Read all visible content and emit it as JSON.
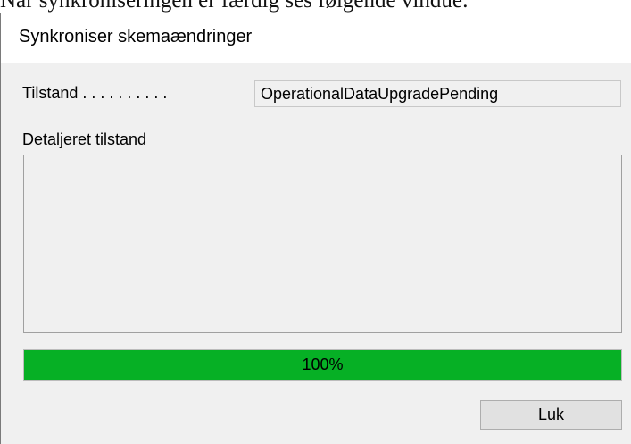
{
  "document": {
    "caption": "Når synkroniseringen er færdig ses følgende vindue:"
  },
  "dialog": {
    "title": "Synkroniser skemaændringer",
    "status_label": "Tilstand . . . . . . . . . .",
    "status_value": "OperationalDataUpgradePending",
    "detail_label": "Detaljeret tilstand",
    "detail_value": "",
    "progress_percent": 100,
    "progress_text": "100%",
    "close_label": "Luk"
  },
  "colors": {
    "progress_fill": "#06b025",
    "dialog_background": "#f0f0f0",
    "titlebar_background": "#ffffff"
  }
}
